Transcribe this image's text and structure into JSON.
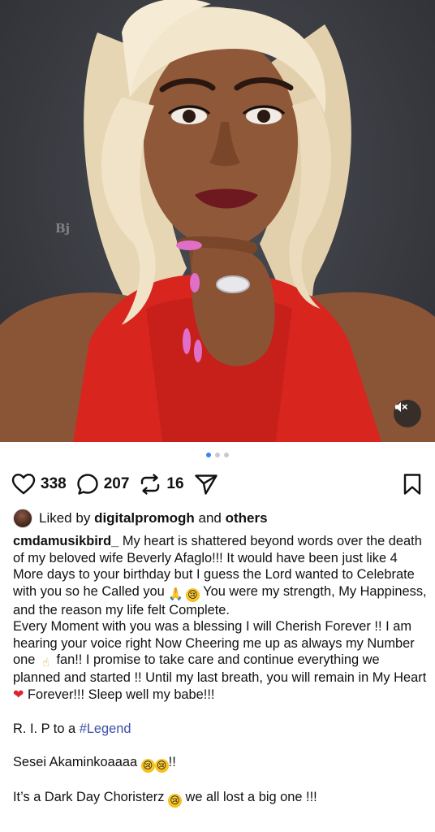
{
  "photo": {
    "watermark": "Bj",
    "mute_icon": "speaker-muted-icon",
    "colors": {
      "background": "#3a3c42",
      "dress": "#d8261f",
      "hair": "#efe2c6",
      "skin": "#8a5436",
      "nails": "#e06fc8",
      "lips": "#6e1820"
    }
  },
  "carousel": {
    "count": 3,
    "active_index": 0,
    "active_color": "#3b82f6"
  },
  "actions": {
    "likes": "338",
    "comments": "207",
    "reposts": "16",
    "icons": [
      "heart-icon",
      "comment-icon",
      "repost-icon",
      "share-icon",
      "bookmark-icon"
    ]
  },
  "liked_by": {
    "prefix": "Liked by",
    "user": "digitalpromogh",
    "and": "and",
    "others": "others"
  },
  "caption": {
    "username": "cmdamusikbird_",
    "p1": " My heart is shattered beyond words over the death of my beloved wife Beverly Afaglo!!! It would have been just like 4 More days to your birthday but I guess the Lord wanted to Celebrate with you so he Called you ",
    "p1_end": " You were my strength, My Happiness, and the reason my life felt Complete.",
    "p2_a": "Every Moment with you was a blessing I will Cherish Forever !! I am hearing your voice right Now Cheering me up as always my Number one ",
    "p2_b": " fan!! I promise to take care and continue everything we planned and started !! Until my last breath, you will remain in My Heart ",
    "p2_c": " Forever!!! Sleep well my babe!!!",
    "rip_prefix": "R. I. P  to a ",
    "hashtag": "#Legend",
    "sesei": "Sesei Akaminkoaaaa ",
    "sesei_end": "!!",
    "dark_a": "It’s a Dark Day Choristerz ",
    "dark_b": " we all lost a big one !!!",
    "hashtag_color": "#3b4fa8"
  }
}
